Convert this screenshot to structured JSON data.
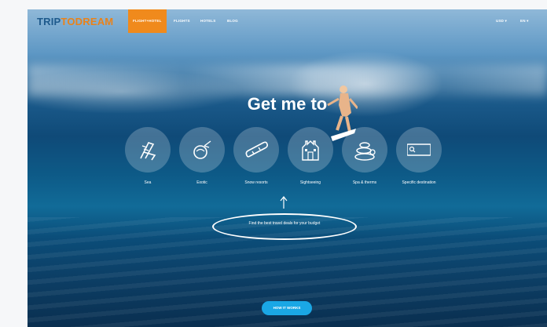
{
  "logo": {
    "part1": "TRIP",
    "part2": "TO",
    "part3": "DREAM"
  },
  "nav": {
    "items": [
      {
        "label": "FLIGHT+HOTEL",
        "active": true
      },
      {
        "label": "FLIGHTS",
        "active": false
      },
      {
        "label": "HOTELS",
        "active": false
      },
      {
        "label": "BLOG",
        "active": false
      }
    ],
    "currency": "USD ▾",
    "language": "EN ▾"
  },
  "hero": {
    "title": "Get me to"
  },
  "options": [
    {
      "label": "Sea",
      "icon": "beach-chair-icon"
    },
    {
      "label": "Exotic",
      "icon": "coconut-icon"
    },
    {
      "label": "Snow resorts",
      "icon": "snowboard-icon"
    },
    {
      "label": "Sightseeing",
      "icon": "castle-icon"
    },
    {
      "label": "Spa & therms",
      "icon": "spa-stones-icon"
    },
    {
      "label": "Specific destination",
      "icon": "search-icon"
    }
  ],
  "callout": "Find the best travel deals for your budget",
  "cta": {
    "label": "HOW IT WORKS"
  },
  "colors": {
    "accent": "#f08a1c",
    "cta": "#1aa7e5",
    "logo_blue": "#1e5a8c"
  }
}
